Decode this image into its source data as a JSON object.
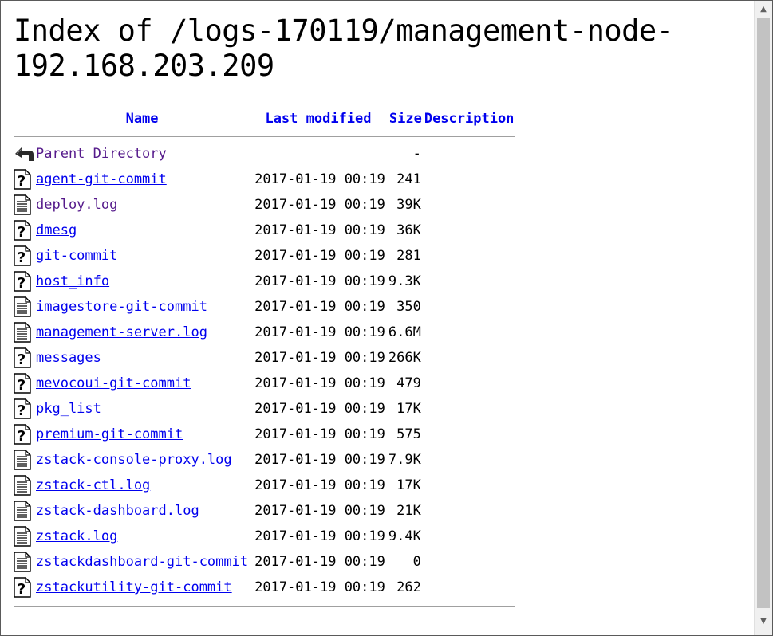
{
  "page": {
    "title": "Index of /logs-170119/management-node-192.168.203.209"
  },
  "columns": {
    "name": "Name",
    "last_modified": "Last modified",
    "size": "Size",
    "description": "Description"
  },
  "parent": {
    "label": "Parent Directory",
    "size": "-",
    "icon": "back-arrow-icon"
  },
  "files": [
    {
      "name": "agent-git-commit",
      "date": "2017-01-19 00:19",
      "size": "241",
      "icon": "unknown-file-icon"
    },
    {
      "name": "deploy.log",
      "date": "2017-01-19 00:19",
      "size": "39K",
      "icon": "text-file-icon",
      "visited": true
    },
    {
      "name": "dmesg",
      "date": "2017-01-19 00:19",
      "size": "36K",
      "icon": "unknown-file-icon"
    },
    {
      "name": "git-commit",
      "date": "2017-01-19 00:19",
      "size": "281",
      "icon": "unknown-file-icon"
    },
    {
      "name": "host_info",
      "date": "2017-01-19 00:19",
      "size": "9.3K",
      "icon": "unknown-file-icon"
    },
    {
      "name": "imagestore-git-commit",
      "date": "2017-01-19 00:19",
      "size": "350",
      "icon": "text-file-icon"
    },
    {
      "name": "management-server.log",
      "date": "2017-01-19 00:19",
      "size": "6.6M",
      "icon": "text-file-icon"
    },
    {
      "name": "messages",
      "date": "2017-01-19 00:19",
      "size": "266K",
      "icon": "unknown-file-icon"
    },
    {
      "name": "mevocoui-git-commit",
      "date": "2017-01-19 00:19",
      "size": "479",
      "icon": "unknown-file-icon"
    },
    {
      "name": "pkg_list",
      "date": "2017-01-19 00:19",
      "size": "17K",
      "icon": "unknown-file-icon"
    },
    {
      "name": "premium-git-commit",
      "date": "2017-01-19 00:19",
      "size": "575",
      "icon": "unknown-file-icon"
    },
    {
      "name": "zstack-console-proxy.log",
      "date": "2017-01-19 00:19",
      "size": "7.9K",
      "icon": "text-file-icon"
    },
    {
      "name": "zstack-ctl.log",
      "date": "2017-01-19 00:19",
      "size": "17K",
      "icon": "text-file-icon"
    },
    {
      "name": "zstack-dashboard.log",
      "date": "2017-01-19 00:19",
      "size": "21K",
      "icon": "text-file-icon"
    },
    {
      "name": "zstack.log",
      "date": "2017-01-19 00:19",
      "size": "9.4K",
      "icon": "text-file-icon"
    },
    {
      "name": "zstackdashboard-git-commit",
      "date": "2017-01-19 00:19",
      "size": "0",
      "icon": "text-file-icon"
    },
    {
      "name": "zstackutility-git-commit",
      "date": "2017-01-19 00:19",
      "size": "262",
      "icon": "unknown-file-icon"
    }
  ],
  "colors": {
    "link": "#0000ee",
    "visited_link": "#551a8b"
  }
}
